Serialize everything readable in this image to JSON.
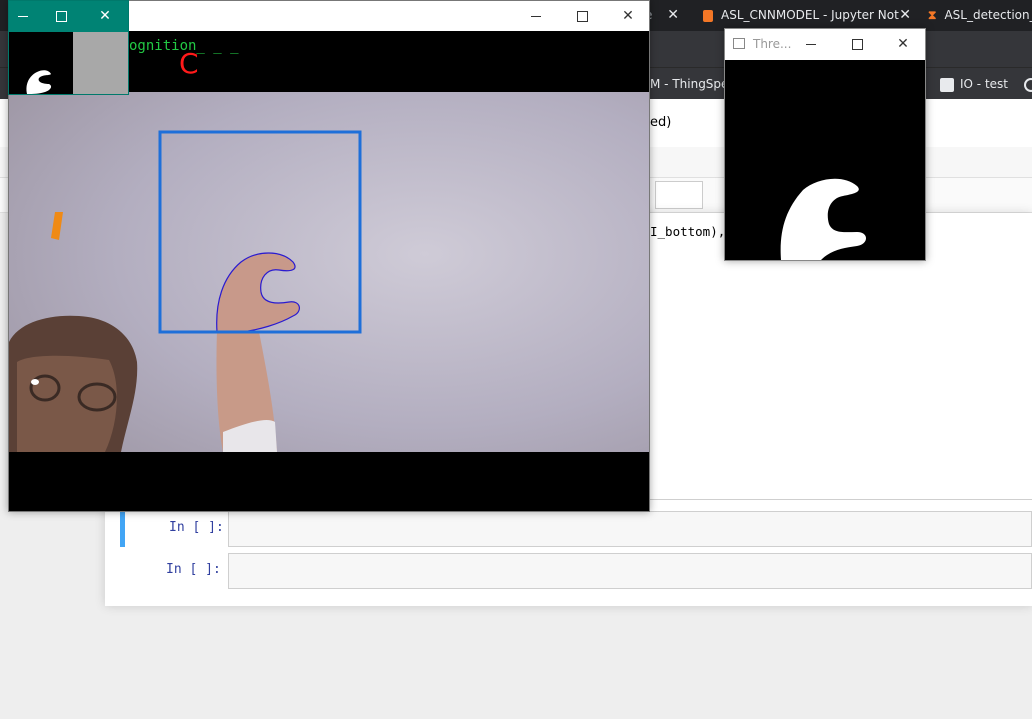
{
  "browser": {
    "tabs": [
      {
        "label": "e",
        "icon": "tab-icon"
      },
      {
        "label": "ASL_CNNMODEL - Jupyter Not",
        "icon": "jupyter-notebook-icon"
      },
      {
        "label": "ASL_detection_",
        "icon": "hourglass-icon"
      }
    ],
    "bookmarks": [
      {
        "label": "M - ThingSpeak",
        "icon": "bookmark-icon"
      },
      {
        "label": "IO - test",
        "icon": "io-icon"
      }
    ]
  },
  "notebook": {
    "header_fragment": "ed)",
    "code_fragment": "I_bottom),",
    "cells": [
      {
        "prompt": "In [ ]:",
        "selected": true
      },
      {
        "prompt": "In [ ]:",
        "selected": false
      }
    ]
  },
  "windows": {
    "main": {
      "overlay_title": "ognition_ _ _",
      "predicted_letter": "C",
      "roi_color": "#1e6fd9",
      "contour_color": "#2a1bd0"
    },
    "threshold": {
      "title": "Thre..."
    },
    "mini": {
      "accent_color": "#008374"
    }
  },
  "colors": {
    "jupyter_accent": "#f37726",
    "selected_cell": "#42a5f5",
    "prompt": "#303f9f",
    "overlay_text": "#22c944",
    "prediction": "#ff1a1a"
  }
}
